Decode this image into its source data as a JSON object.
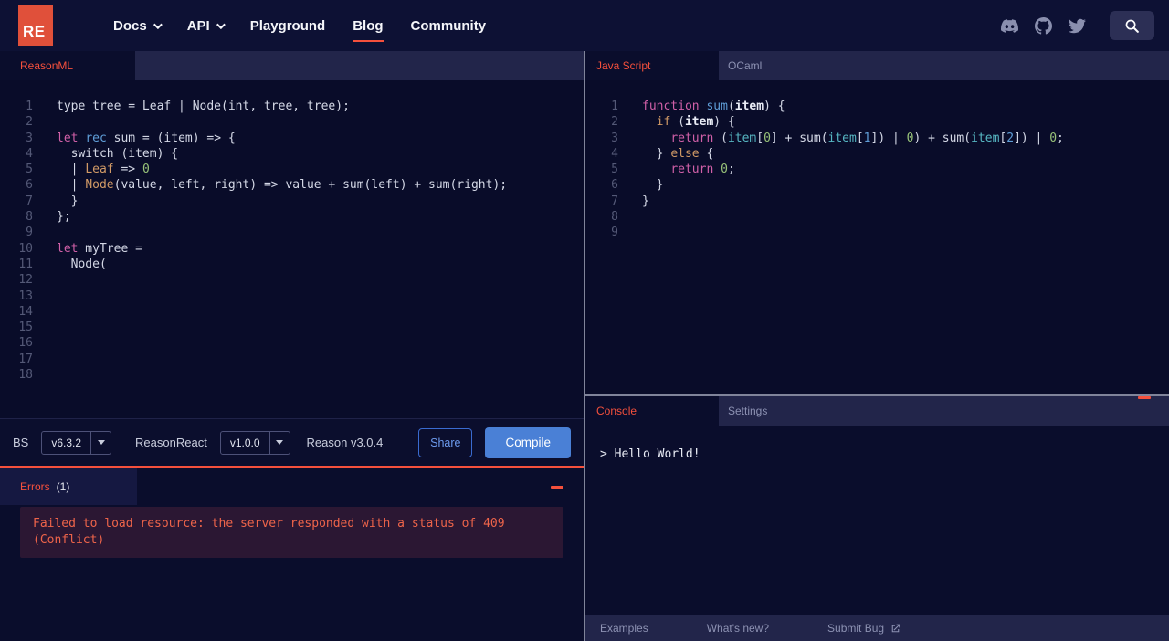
{
  "nav": {
    "logo_text": "RE",
    "items": [
      {
        "label": "Docs",
        "has_caret": true
      },
      {
        "label": "API",
        "has_caret": true
      },
      {
        "label": "Playground",
        "has_caret": false
      },
      {
        "label": "Blog",
        "has_caret": false,
        "active": true
      },
      {
        "label": "Community",
        "has_caret": false
      }
    ],
    "social_icons": [
      "discord",
      "github",
      "twitter"
    ]
  },
  "left": {
    "tab_label": "ReasonML",
    "editor_lines": [
      [
        [
          "d",
          "type tree = Leaf | Node(int, tree, tree);"
        ]
      ],
      [],
      [
        [
          "p",
          "let"
        ],
        [
          "d",
          " "
        ],
        [
          "b",
          "rec"
        ],
        [
          "d",
          " sum = (item) => {"
        ]
      ],
      [
        [
          "d",
          "  switch (item) {"
        ]
      ],
      [
        [
          "d",
          "  | "
        ],
        [
          "o",
          "Leaf"
        ],
        [
          "d",
          " => "
        ],
        [
          "g",
          "0"
        ]
      ],
      [
        [
          "d",
          "  | "
        ],
        [
          "o",
          "Node"
        ],
        [
          "d",
          "(value, left, right) => value + sum(left) + sum(right);"
        ]
      ],
      [
        [
          "d",
          "  }"
        ]
      ],
      [
        [
          "d",
          "};"
        ]
      ],
      [],
      [
        [
          "p",
          "let"
        ],
        [
          "d",
          " myTree ="
        ]
      ],
      [
        [
          "d",
          "  Node("
        ]
      ],
      [],
      [],
      [],
      [],
      [],
      [],
      []
    ],
    "toolbar": {
      "bs_label": "BS",
      "bs_version": "v6.3.2",
      "reasonreact_label": "ReasonReact",
      "reasonreact_version": "v1.0.0",
      "reason_version": "Reason v3.0.4",
      "share_label": "Share",
      "compile_label": "Compile"
    },
    "errors": {
      "title": "Errors",
      "count": "(1)",
      "message": "Failed to load resource: the server responded with a status of 409 (Conflict)"
    }
  },
  "right": {
    "tabs": {
      "javascript": "Java Script",
      "ocaml": "OCaml"
    },
    "editor_lines": [
      [
        [
          "p",
          "function"
        ],
        [
          "d",
          " "
        ],
        [
          "b",
          "sum"
        ],
        [
          "d",
          "("
        ],
        [
          "w",
          "item"
        ],
        [
          "d",
          ") {"
        ]
      ],
      [
        [
          "d",
          "  "
        ],
        [
          "o",
          "if"
        ],
        [
          "d",
          " ("
        ],
        [
          "w",
          "item"
        ],
        [
          "d",
          ") {"
        ]
      ],
      [
        [
          "d",
          "    "
        ],
        [
          "p",
          "return"
        ],
        [
          "d",
          " ("
        ],
        [
          "t",
          "item"
        ],
        [
          "d",
          "["
        ],
        [
          "g",
          "0"
        ],
        [
          "d",
          "] + sum("
        ],
        [
          "t",
          "item"
        ],
        [
          "d",
          "["
        ],
        [
          "b",
          "1"
        ],
        [
          "d",
          "]) | "
        ],
        [
          "g",
          "0"
        ],
        [
          "d",
          ") + sum("
        ],
        [
          "t",
          "item"
        ],
        [
          "d",
          "["
        ],
        [
          "b",
          "2"
        ],
        [
          "d",
          "]) | "
        ],
        [
          "g",
          "0"
        ],
        [
          "d",
          ";"
        ]
      ],
      [
        [
          "d",
          "  } "
        ],
        [
          "o",
          "else"
        ],
        [
          "d",
          " {"
        ]
      ],
      [
        [
          "d",
          "    "
        ],
        [
          "p",
          "return"
        ],
        [
          "d",
          " "
        ],
        [
          "g",
          "0"
        ],
        [
          "d",
          ";"
        ]
      ],
      [
        [
          "d",
          "  }"
        ]
      ],
      [
        [
          "d",
          "}"
        ]
      ],
      [],
      []
    ],
    "console": {
      "tab_label": "Console",
      "settings_label": "Settings",
      "output": "> Hello World!"
    },
    "footer": [
      "Examples",
      "What's new?",
      "Submit Bug"
    ]
  },
  "colors": {
    "accent_red": "#f5503c",
    "logo_red": "#e0503a",
    "compile_blue": "#4a80d6",
    "error_text": "#ee644a",
    "error_box_bg": "#2b1733",
    "editor_bg": "#090c29",
    "bar_bg": "#22254a"
  }
}
